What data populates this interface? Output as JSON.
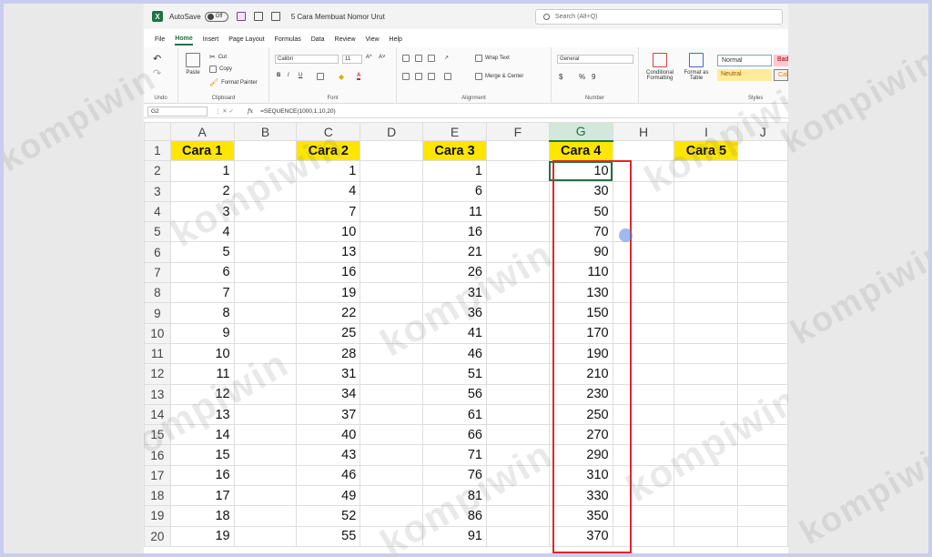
{
  "titlebar": {
    "app_logo": "X",
    "autosave_label": "AutoSave",
    "autosave_state": "Off",
    "document_title": "5 Cara Membuat Nomor Urut",
    "search_placeholder": "Search (Alt+Q)"
  },
  "menu": {
    "tabs": [
      "File",
      "Home",
      "Insert",
      "Page Layout",
      "Formulas",
      "Data",
      "Review",
      "View",
      "Help"
    ],
    "active": "Home"
  },
  "ribbon": {
    "undo_label": "Undo",
    "clipboard": {
      "paste": "Paste",
      "cut": "Cut",
      "copy": "Copy",
      "format_painter": "Format Painter",
      "label": "Clipboard"
    },
    "font": {
      "name": "Calibri",
      "size": "11",
      "bold": "B",
      "italic": "I",
      "underline": "U",
      "grow": "A^",
      "shrink": "A˅",
      "color": "A",
      "label": "Font"
    },
    "alignment": {
      "wrap_text": "Wrap Text",
      "merge_center": "Merge & Center",
      "label": "Alignment"
    },
    "number": {
      "format": "General",
      "currency": "$",
      "percent": "%",
      "comma": "9",
      "label": "Number"
    },
    "styles": {
      "conditional": "Conditional Formatting",
      "format_table": "Format as Table",
      "normal": "Normal",
      "bad": "Bad",
      "neutral": "Neutral",
      "calc": "Calc",
      "label": "Styles"
    }
  },
  "formula_bar": {
    "name_box": "G2",
    "fx": "fx",
    "formula": "=SEQUENCE(1000,1,10,20)"
  },
  "sheet": {
    "columns": [
      "A",
      "B",
      "C",
      "D",
      "E",
      "F",
      "G",
      "H",
      "I",
      "J"
    ],
    "selected_column": "G",
    "headers": {
      "A": "Cara 1",
      "C": "Cara 2",
      "E": "Cara 3",
      "G": "Cara 4",
      "I": "Cara 5"
    },
    "rows": [
      {
        "n": "1"
      },
      {
        "n": "2",
        "A": "1",
        "C": "1",
        "E": "1",
        "G": "10"
      },
      {
        "n": "3",
        "A": "2",
        "C": "4",
        "E": "6",
        "G": "30"
      },
      {
        "n": "4",
        "A": "3",
        "C": "7",
        "E": "11",
        "G": "50"
      },
      {
        "n": "5",
        "A": "4",
        "C": "10",
        "E": "16",
        "G": "70"
      },
      {
        "n": "6",
        "A": "5",
        "C": "13",
        "E": "21",
        "G": "90"
      },
      {
        "n": "7",
        "A": "6",
        "C": "16",
        "E": "26",
        "G": "110"
      },
      {
        "n": "8",
        "A": "7",
        "C": "19",
        "E": "31",
        "G": "130"
      },
      {
        "n": "9",
        "A": "8",
        "C": "22",
        "E": "36",
        "G": "150"
      },
      {
        "n": "10",
        "A": "9",
        "C": "25",
        "E": "41",
        "G": "170"
      },
      {
        "n": "11",
        "A": "10",
        "C": "28",
        "E": "46",
        "G": "190"
      },
      {
        "n": "12",
        "A": "11",
        "C": "31",
        "E": "51",
        "G": "210"
      },
      {
        "n": "13",
        "A": "12",
        "C": "34",
        "E": "56",
        "G": "230"
      },
      {
        "n": "14",
        "A": "13",
        "C": "37",
        "E": "61",
        "G": "250"
      },
      {
        "n": "15",
        "A": "14",
        "C": "40",
        "E": "66",
        "G": "270"
      },
      {
        "n": "16",
        "A": "15",
        "C": "43",
        "E": "71",
        "G": "290"
      },
      {
        "n": "17",
        "A": "16",
        "C": "46",
        "E": "76",
        "G": "310"
      },
      {
        "n": "18",
        "A": "17",
        "C": "49",
        "E": "81",
        "G": "330"
      },
      {
        "n": "19",
        "A": "18",
        "C": "52",
        "E": "86",
        "G": "350"
      },
      {
        "n": "20",
        "A": "19",
        "C": "55",
        "E": "91",
        "G": "370"
      }
    ]
  },
  "watermark": "kompiwin",
  "colors": {
    "excel_green": "#1f7244",
    "header_yellow": "#ffe600",
    "highlight_red": "#e0262b"
  }
}
